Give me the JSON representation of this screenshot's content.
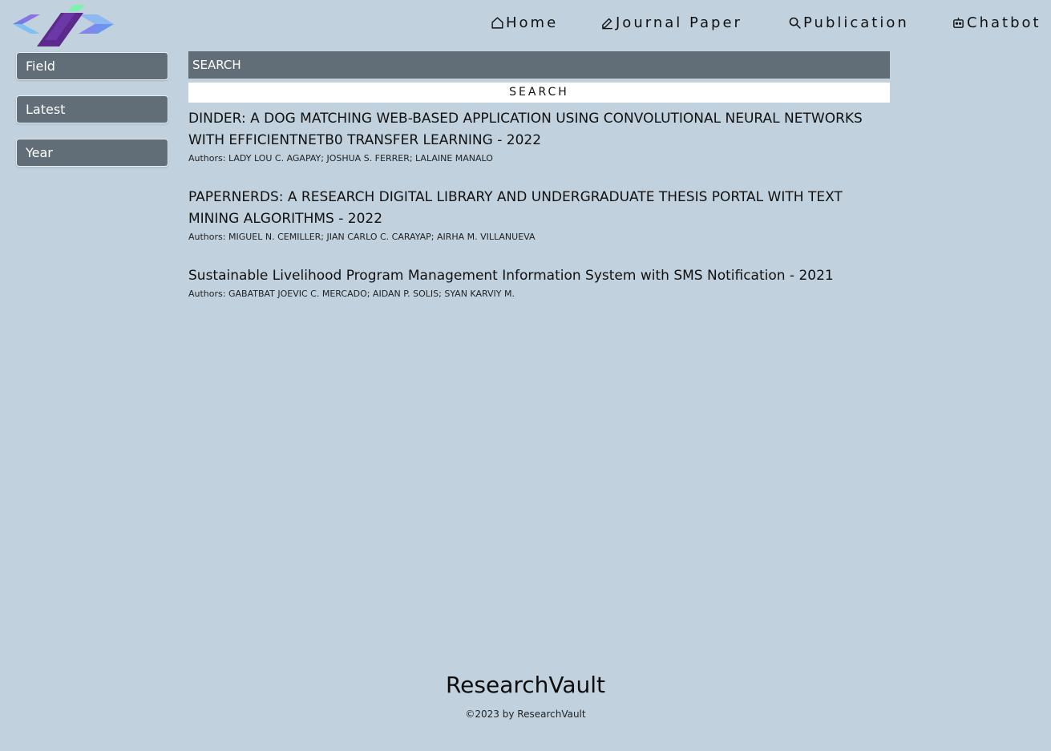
{
  "nav": {
    "home": {
      "label": "Home",
      "icon": "home-icon"
    },
    "journal": {
      "label": "Journal Paper",
      "icon": "pencil-icon"
    },
    "publication": {
      "label": "Publication",
      "icon": "search-icon"
    },
    "chatbot": {
      "label": "Chatbot",
      "icon": "robot-icon"
    }
  },
  "sidebar": {
    "field_label": "Field",
    "latest_label": "Latest",
    "year_label": "Year"
  },
  "search": {
    "placeholder": "SEARCH",
    "button_label": "SEARCH"
  },
  "results": [
    {
      "title": "DINDER: A DOG MATCHING WEB-BASED APPLICATION USING CONVOLUTIONAL NEURAL NETWORKS WITH EFFICIENTNETB0 TRANSFER LEARNING - 2022",
      "authors": "Authors: LADY LOU C. AGAPAY; JOSHUA S. FERRER; LALAINE MANALO"
    },
    {
      "title": "PAPERNERDS: A RESEARCH DIGITAL LIBRARY AND UNDERGRADUATE THESIS PORTAL WITH TEXT MINING ALGORITHMS - 2022",
      "authors": "Authors: MIGUEL N. CEMILLER; JIAN CARLO C. CARAYAP; AIRHA M. VILLANUEVA"
    },
    {
      "title": "Sustainable Livelihood Program Management Information System with SMS Notification - 2021",
      "authors": "Authors: GABATBAT JOEVIC C. MERCADO; AIDAN P. SOLIS; SYAN KARVIY M."
    }
  ],
  "footer": {
    "brand": "ResearchVault",
    "copyright": "©2023 by ResearchVault"
  },
  "colors": {
    "background": "#c1d2de",
    "panel": "#616e77",
    "logo_purple": "#5b2a8c",
    "logo_green": "#6ee7b7",
    "logo_blue": "#7c8cf0"
  }
}
